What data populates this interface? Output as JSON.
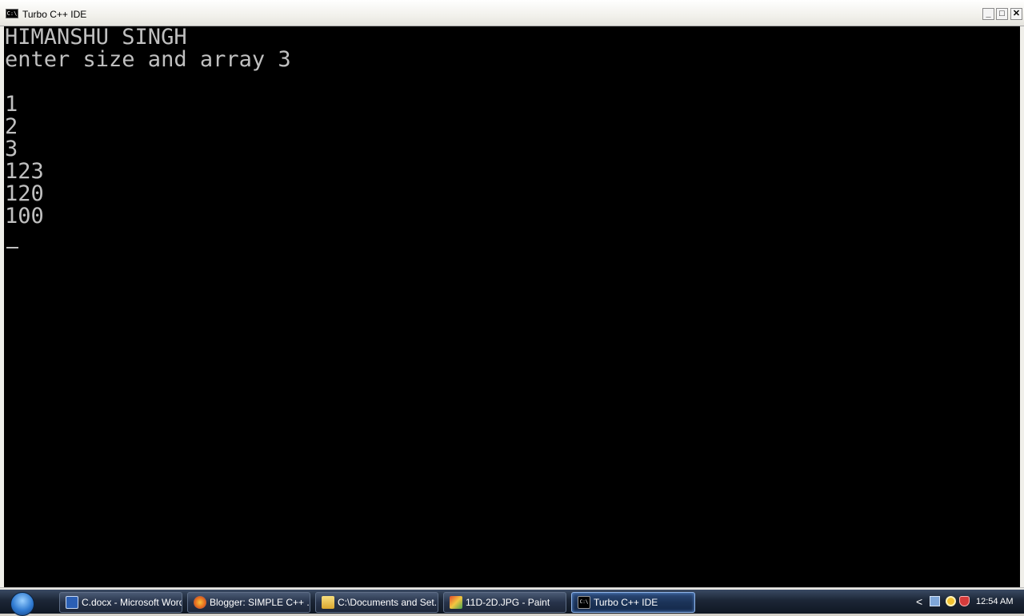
{
  "window": {
    "title": "Turbo C++ IDE",
    "icon_label": "C:\\",
    "minimize_glyph": "_",
    "maximize_glyph": "□",
    "close_glyph": "✕"
  },
  "console": {
    "lines": [
      "HIMANSHU SINGH",
      "enter size and array 3",
      "",
      "1",
      "2",
      "3",
      "123",
      "120",
      "100"
    ],
    "text_color": "#c0c0c0",
    "background": "#000000"
  },
  "taskbar": {
    "items": [
      {
        "label": "C.docx - Microsoft Word",
        "icon": "word-icon"
      },
      {
        "label": "Blogger: SIMPLE C++ ...",
        "icon": "firefox-icon"
      },
      {
        "label": "C:\\Documents and Set...",
        "icon": "folder-icon"
      },
      {
        "label": "11D-2D.JPG - Paint",
        "icon": "paint-icon"
      },
      {
        "label": "Turbo C++ IDE",
        "icon": "console-icon",
        "active": true
      }
    ],
    "tray": {
      "chevron": "<",
      "clock": "12:54 AM"
    }
  }
}
